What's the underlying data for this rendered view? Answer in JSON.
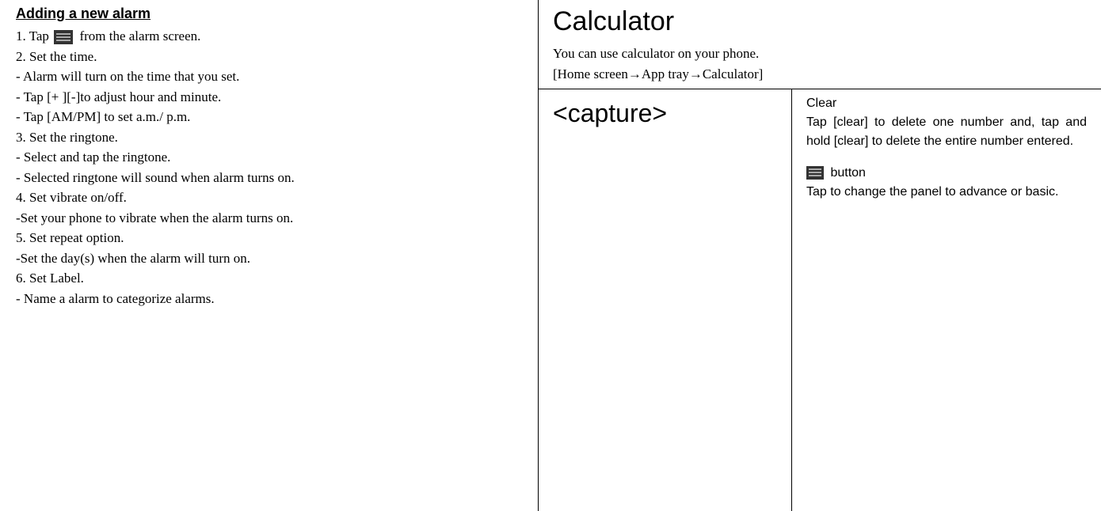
{
  "left": {
    "heading": "Adding a new alarm",
    "lines": {
      "l1a": "1. Tap ",
      "l1b": " from the alarm screen.",
      "l2": "2. Set the time.",
      "l3": "- Alarm will turn on the time that you set.",
      "l4": "- Tap [+ ][-]to adjust hour and minute.",
      "l5": "- Tap [AM/PM] to set a.m./ p.m.",
      "l6": "3. Set the ringtone.",
      "l7": "- Select and tap the ringtone.",
      "l8": "- Selected ringtone will sound when alarm turns on.",
      "l9": "4. Set vibrate on/off.",
      "l10": "-Set your phone to vibrate when the alarm turns on.",
      "l11": "5. Set repeat option.",
      "l12": "-Set the day(s) when the alarm will turn on.",
      "l13": "6. Set Label.",
      "l14": "- Name a alarm to categorize alarms."
    }
  },
  "right": {
    "title": "Calculator",
    "subtitle": "You can use calculator on your phone.",
    "path": "[Home screen→App tray→Calculator]",
    "capture": "<capture>",
    "clear": {
      "heading": "Clear",
      "body": "Tap [clear] to delete one number and, tap and hold [clear] to delete the entire number entered.",
      "button_label": " button",
      "button_body": "Tap to change the panel to advance or basic."
    }
  }
}
